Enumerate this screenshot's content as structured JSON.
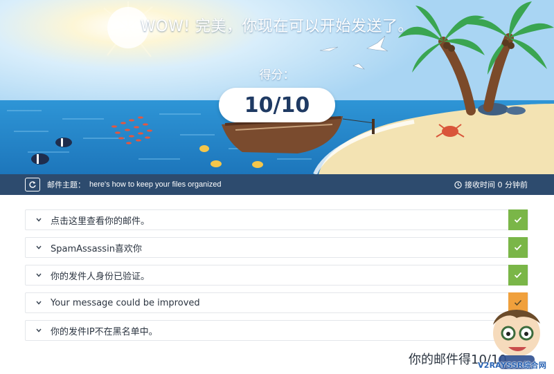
{
  "hero": {
    "headline": "WOW! 完美，你现在可以开始发送了。",
    "score_label": "得分：",
    "score_value": "10/10"
  },
  "infobar": {
    "refresh_icon": "refresh-icon",
    "subject_label": "邮件主题：",
    "subject_text": "here's how to keep your files organized",
    "clock_icon": "clock-icon",
    "received": "接收时间 0 分钟前"
  },
  "results": [
    {
      "label": "点击这里查看你的邮件。",
      "status": "check-icon",
      "status_color": "#7ab648"
    },
    {
      "label": "SpamAssassin喜欢你",
      "status": "check-icon",
      "status_color": "#7ab648"
    },
    {
      "label": "你的发件人身份已验证。",
      "status": "check-icon",
      "status_color": "#7ab648"
    },
    {
      "label": "Your message could be improved",
      "status": "check-icon",
      "status_color": "#f0a03c"
    },
    {
      "label": "你的发件IP不在黑名单中。",
      "status": "check-icon",
      "status_color": "#7ab648"
    }
  ],
  "summary": {
    "prefix": "你的邮件得",
    "score": "10/10"
  },
  "watermark": {
    "text": "V2RAYSSR综合网"
  },
  "colors": {
    "navy": "#2d4b6e",
    "ok": "#7ab648",
    "warn": "#f0a03c",
    "sky": "#bfe0f6",
    "sea": "#1e86c8",
    "sand": "#f3e3b3"
  }
}
